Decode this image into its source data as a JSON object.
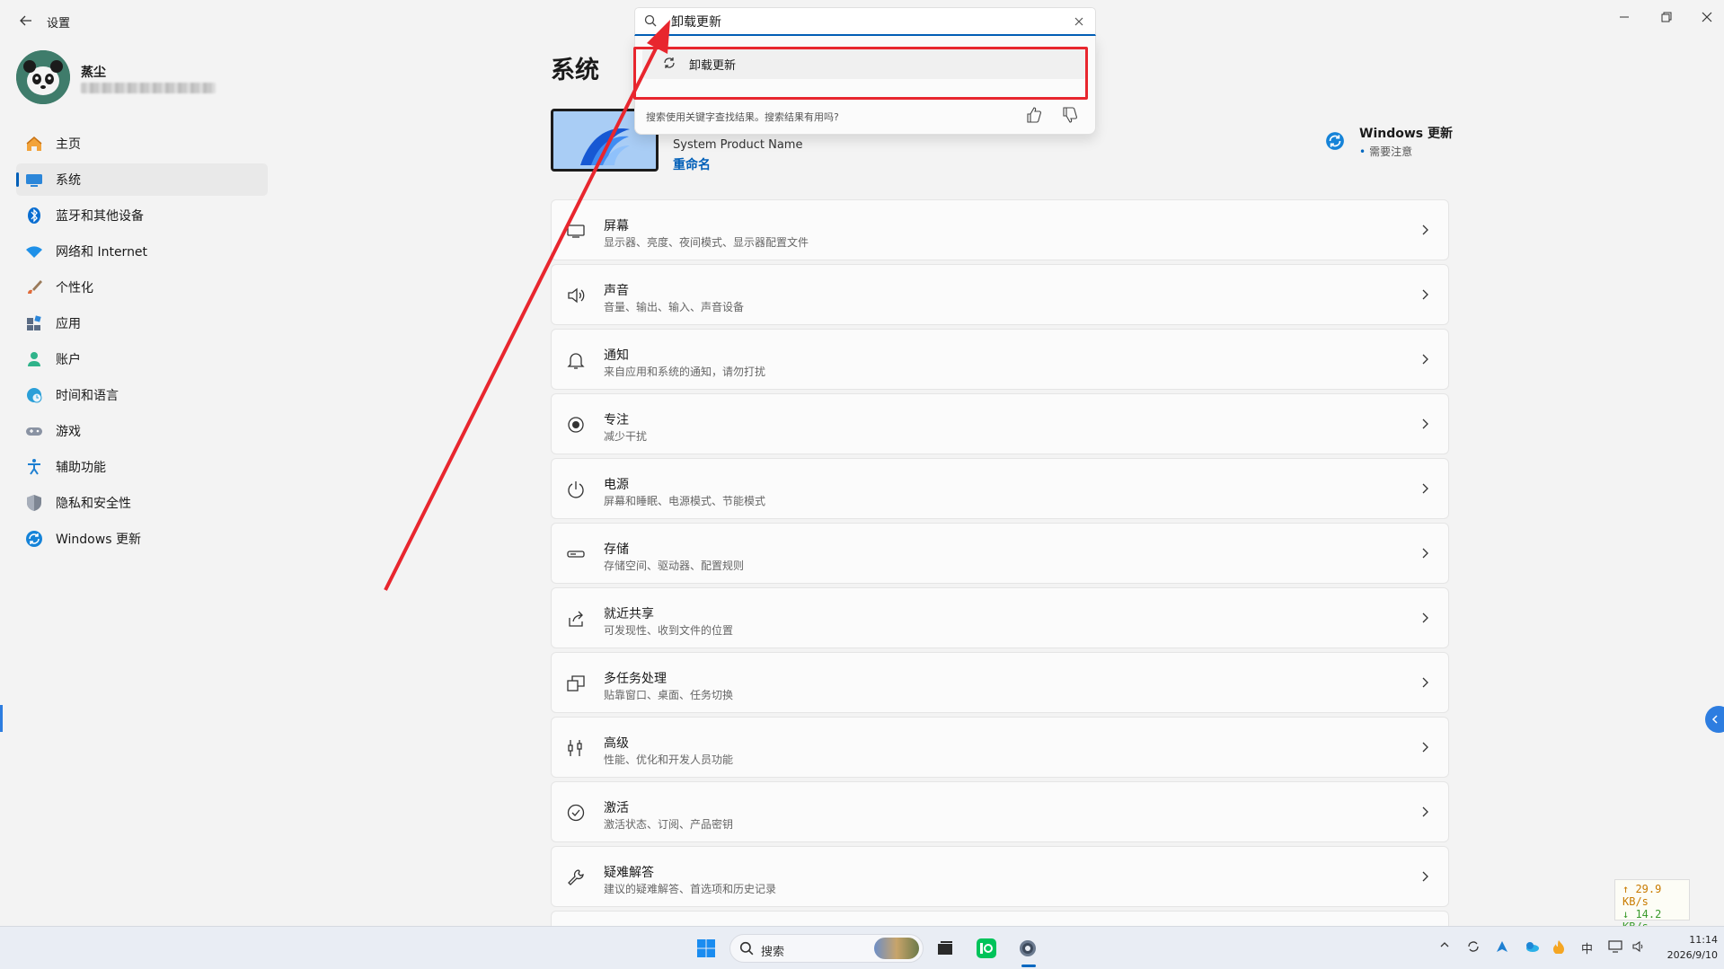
{
  "window": {
    "title": "设置"
  },
  "profile": {
    "name": "蒸尘"
  },
  "nav": {
    "items": [
      {
        "label": "主页"
      },
      {
        "label": "系统"
      },
      {
        "label": "蓝牙和其他设备"
      },
      {
        "label": "网络和 Internet"
      },
      {
        "label": "个性化"
      },
      {
        "label": "应用"
      },
      {
        "label": "账户"
      },
      {
        "label": "时间和语言"
      },
      {
        "label": "游戏"
      },
      {
        "label": "辅助功能"
      },
      {
        "label": "隐私和安全性"
      },
      {
        "label": "Windows 更新"
      }
    ],
    "active_index": 1
  },
  "page": {
    "title": "系统"
  },
  "device": {
    "name": "System Product Name",
    "rename_label": "重命名"
  },
  "windows_update": {
    "title": "Windows 更新",
    "status": "需要注意"
  },
  "cards": [
    {
      "title": "屏幕",
      "subtitle": "显示器、亮度、夜间模式、显示器配置文件",
      "icon": "monitor-icon"
    },
    {
      "title": "声音",
      "subtitle": "音量、输出、输入、声音设备",
      "icon": "speaker-icon"
    },
    {
      "title": "通知",
      "subtitle": "来自应用和系统的通知，请勿打扰",
      "icon": "bell-icon"
    },
    {
      "title": "专注",
      "subtitle": "减少干扰",
      "icon": "focus-icon"
    },
    {
      "title": "电源",
      "subtitle": "屏幕和睡眠、电源模式、节能模式",
      "icon": "power-icon"
    },
    {
      "title": "存储",
      "subtitle": "存储空间、驱动器、配置规则",
      "icon": "storage-icon"
    },
    {
      "title": "就近共享",
      "subtitle": "可发现性、收到文件的位置",
      "icon": "share-icon"
    },
    {
      "title": "多任务处理",
      "subtitle": "贴靠窗口、桌面、任务切换",
      "icon": "multitask-icon"
    },
    {
      "title": "高级",
      "subtitle": "性能、优化和开发人员功能",
      "icon": "advanced-icon"
    },
    {
      "title": "激活",
      "subtitle": "激活状态、订阅、产品密钥",
      "icon": "check-circle-icon"
    },
    {
      "title": "疑难解答",
      "subtitle": "建议的疑难解答、首选项和历史记录",
      "icon": "wrench-icon"
    }
  ],
  "search": {
    "value": "卸载更新",
    "result_label": "卸载更新",
    "feedback_text": "搜索使用关键字查找结果。搜索结果有用吗?"
  },
  "net_speed": {
    "up": "↑ 29.9 KB/s",
    "down": "↓ 14.2 KB/s"
  },
  "taskbar": {
    "search_label": "搜索",
    "ime": "中",
    "time": "11:14",
    "date": "2026/9/10"
  },
  "colors": {
    "accent": "#005fb8",
    "highlight_red": "#e8262e",
    "background": "#f3f3f3"
  }
}
